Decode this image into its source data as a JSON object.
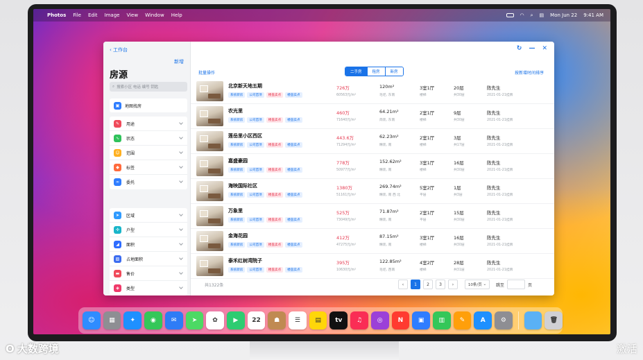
{
  "menubar": {
    "app": "Photos",
    "items": [
      "File",
      "Edit",
      "Image",
      "View",
      "Window",
      "Help"
    ],
    "date": "Mon Jun 22",
    "time": "9:41 AM"
  },
  "sidebar": {
    "back_label": "工作台",
    "add_label": "新增",
    "title": "房源",
    "search_placeholder": "搜索小区 电话 编号 钥匙",
    "map_label": "地图找房",
    "group1": [
      {
        "label": "用途",
        "icon": "use-icon",
        "color": "#f04a5a"
      },
      {
        "label": "状态",
        "icon": "status-icon",
        "color": "#2fc25b"
      },
      {
        "label": "范围",
        "icon": "range-icon",
        "color": "#ffb020"
      },
      {
        "label": "标签",
        "icon": "tag-icon",
        "color": "#ff6b3d"
      },
      {
        "label": "委托",
        "icon": "entrust-icon",
        "color": "#2f7dff"
      }
    ],
    "group2": [
      {
        "label": "区域",
        "icon": "region-icon",
        "color": "#2f9bff"
      },
      {
        "label": "户型",
        "icon": "layout-icon",
        "color": "#19b5c9"
      },
      {
        "label": "面积",
        "icon": "area-icon",
        "color": "#2f6dff"
      },
      {
        "label": "占地面积",
        "icon": "land-area-icon",
        "color": "#3c6cf0"
      },
      {
        "label": "售价",
        "icon": "price-icon",
        "color": "#f04a5a"
      },
      {
        "label": "类型",
        "icon": "type-icon",
        "color": "#f03a6a"
      }
    ]
  },
  "main": {
    "batch_label": "批量操作",
    "tabs": [
      {
        "label": "二手房",
        "active": true
      },
      {
        "label": "租房",
        "active": false
      },
      {
        "label": "新房",
        "active": false
      }
    ],
    "sort_label": "按新增时间排序",
    "listings": [
      {
        "name": "北京新天地五期",
        "tags": [
          "系统新房",
          "公司首项",
          "楼盘卖点",
          "楼盘卖点"
        ],
        "price": "726万",
        "unit": "60563元/m²",
        "area": "120m²",
        "decoration": "毛坯, 东南",
        "layout": "3室1厅",
        "orientation": "楼梯",
        "floor": "20层",
        "total": "共30层",
        "agent": "陈先生",
        "date": "2021-01-21挂牌"
      },
      {
        "name": "农光里",
        "tags": [
          "系统新房",
          "公司首项",
          "楼盘卖点",
          "楼盘卖点"
        ],
        "price": "460万",
        "unit": "71640元/m²",
        "area": "64.21m²",
        "decoration": "简装, 东南",
        "layout": "2室1厅",
        "orientation": "楼梯",
        "floor": "9层",
        "total": "共30层",
        "agent": "陈先生",
        "date": "2021-01-21挂牌"
      },
      {
        "name": "莲岳里小区西区",
        "tags": [
          "系统新房",
          "公司首项",
          "楼盘卖点",
          "楼盘卖点"
        ],
        "price": "443.6万",
        "unit": "71294元/m²",
        "area": "62.23m²",
        "decoration": "精装, 南",
        "layout": "2室1厅",
        "orientation": "楼梯",
        "floor": "3层",
        "total": "共17层",
        "agent": "陈先生",
        "date": "2021-01-21挂牌"
      },
      {
        "name": "嘉盛豪园",
        "tags": [
          "系统新房",
          "公司首项",
          "楼盘卖点",
          "楼盘卖点"
        ],
        "price": "778万",
        "unit": "50977元/m²",
        "area": "152.62m²",
        "decoration": "精装, 南",
        "layout": "3室1厅",
        "orientation": "楼梯",
        "floor": "16层",
        "total": "共30层",
        "agent": "陈先生",
        "date": "2021-01-21挂牌"
      },
      {
        "name": "海映国际社区",
        "tags": [
          "系统新房",
          "公司首项",
          "楼盘卖点",
          "楼盘卖点"
        ],
        "price": "1380万",
        "unit": "51161元/m²",
        "area": "269.74m²",
        "decoration": "精装, 南 西 北",
        "layout": "5室2厅",
        "orientation": "平层",
        "floor": "1层",
        "total": "共3层",
        "agent": "陈先生",
        "date": "2021-01-21挂牌"
      },
      {
        "name": "万象里",
        "tags": [
          "系统新房",
          "公司首项",
          "楼盘卖点",
          "楼盘卖点"
        ],
        "price": "525万",
        "unit": "73049元/m²",
        "area": "71.87m²",
        "decoration": "精装, 南",
        "layout": "2室1厅",
        "orientation": "平层",
        "floor": "15层",
        "total": "共30层",
        "agent": "陈先生",
        "date": "2021-01-21挂牌"
      },
      {
        "name": "金海花园",
        "tags": [
          "系统新房",
          "公司首项",
          "楼盘卖点",
          "楼盘卖点"
        ],
        "price": "412万",
        "unit": "47275元/m²",
        "area": "87.15m²",
        "decoration": "精装, 南",
        "layout": "3室1厅",
        "orientation": "楼梯",
        "floor": "16层",
        "total": "共30层",
        "agent": "陈先生",
        "date": "2021-01-21挂牌"
      },
      {
        "name": "泰禾红树湾院子",
        "tags": [
          "系统新房",
          "公司首项",
          "楼盘卖点",
          "楼盘卖点"
        ],
        "price": "395万",
        "unit": "10630元/m²",
        "area": "122.85m²",
        "decoration": "毛坯, 西南",
        "layout": "4室2厅",
        "orientation": "楼梯",
        "floor": "28层",
        "total": "共31层",
        "agent": "陈先生",
        "date": "2021-01-21挂牌"
      }
    ],
    "footer": {
      "count": "共1322条",
      "pages": [
        "1",
        "2",
        "3"
      ],
      "per_page": "10条/页",
      "jump_label": "跳至",
      "page_word": "页"
    }
  },
  "dock": [
    {
      "name": "finder-icon",
      "color": "#2f8cff",
      "glyph": "☺"
    },
    {
      "name": "launchpad-icon",
      "color": "#8e8e93",
      "glyph": "▦"
    },
    {
      "name": "safari-icon",
      "color": "#1e90ff",
      "glyph": "✦"
    },
    {
      "name": "messages-icon",
      "color": "#34c759",
      "glyph": "◉"
    },
    {
      "name": "mail-icon",
      "color": "#2e7cf6",
      "glyph": "✉"
    },
    {
      "name": "maps-icon",
      "color": "#4cd964",
      "glyph": "➤"
    },
    {
      "name": "photos-icon",
      "color": "#ffffff",
      "glyph": "✿"
    },
    {
      "name": "facetime-icon",
      "color": "#2ecc71",
      "glyph": "▶"
    },
    {
      "name": "calendar-icon",
      "color": "#ffffff",
      "glyph": "22"
    },
    {
      "name": "contacts-icon",
      "color": "#c08a52",
      "glyph": "☗"
    },
    {
      "name": "reminders-icon",
      "color": "#ffffff",
      "glyph": "☰"
    },
    {
      "name": "notes-icon",
      "color": "#ffd60a",
      "glyph": "▤"
    },
    {
      "name": "tv-icon",
      "color": "#111111",
      "glyph": "tv"
    },
    {
      "name": "music-icon",
      "color": "#fa2d55",
      "glyph": "♫"
    },
    {
      "name": "podcasts-icon",
      "color": "#9b40d8",
      "glyph": "◎"
    },
    {
      "name": "news-icon",
      "color": "#ff3b30",
      "glyph": "N"
    },
    {
      "name": "keynote-icon",
      "color": "#2f7dff",
      "glyph": "▣"
    },
    {
      "name": "numbers-icon",
      "color": "#34c759",
      "glyph": "▥"
    },
    {
      "name": "pages-icon",
      "color": "#ff9f0a",
      "glyph": "✎"
    },
    {
      "name": "appstore-icon",
      "color": "#1e90ff",
      "glyph": "A"
    },
    {
      "name": "system-preferences-icon",
      "color": "#8e8e93",
      "glyph": "⚙"
    }
  ],
  "dock_right": [
    {
      "name": "downloads-folder-icon",
      "color": "#5ab1f5",
      "glyph": ""
    },
    {
      "name": "trash-icon",
      "color": "#d0d0d4",
      "glyph": "🗑"
    }
  ],
  "watermark": {
    "left": "大数跨境",
    "right": "激活"
  }
}
